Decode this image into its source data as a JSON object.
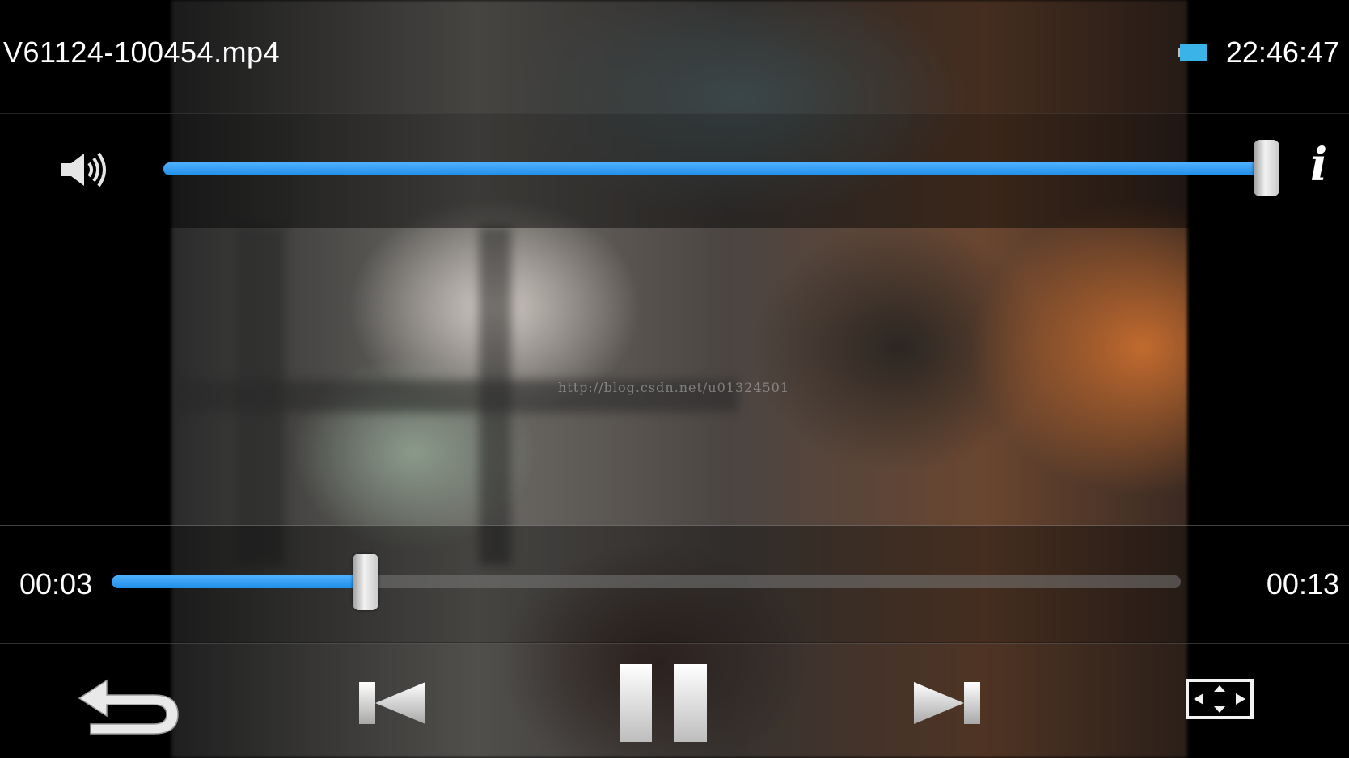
{
  "header": {
    "file_name": "V61124-100454.mp4",
    "clock": "22:46:47",
    "battery_color": "#3ab4e8"
  },
  "volume": {
    "level": 1.0,
    "icon": "speaker-icon",
    "info_label": "i"
  },
  "playback": {
    "current_time": "00:03",
    "duration": "00:13",
    "position_seconds": 3,
    "duration_seconds": 13
  },
  "controls": {
    "back": "back-arrow-icon",
    "previous": "skip-previous-icon",
    "pause": "pause-icon",
    "next": "skip-next-icon",
    "fullscreen": "fullscreen-icon"
  },
  "watermark": "http://blog.csdn.net/u01324501",
  "colors": {
    "accent": "#1f8fe8",
    "background": "#000000"
  }
}
